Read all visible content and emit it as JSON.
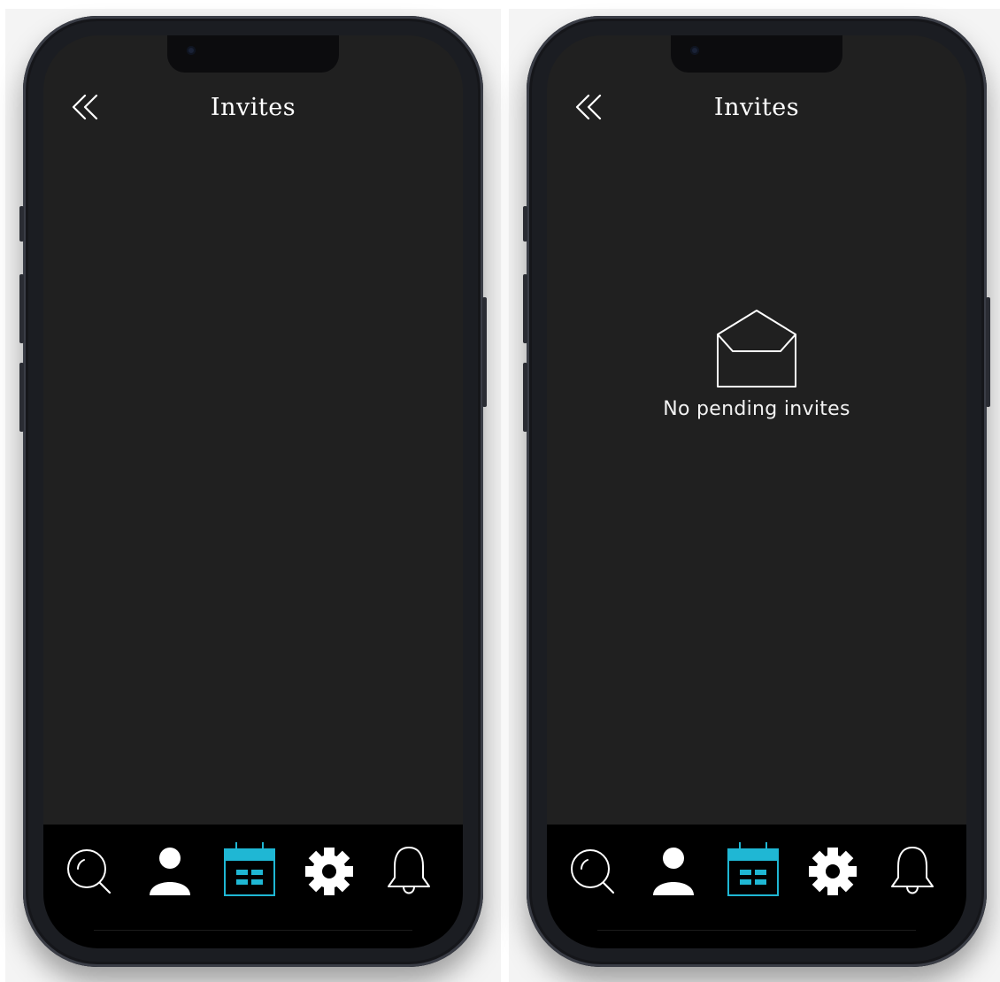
{
  "theme": {
    "accent": "#1fb7d4",
    "screen_bg": "#202020",
    "tabbar_bg": "#000000",
    "text": "#ffffff"
  },
  "screens": [
    {
      "header": {
        "title": "Invites",
        "back_icon": "double-chevron-left-icon"
      },
      "empty_state": null,
      "tabs": [
        {
          "id": "search",
          "icon": "search-icon",
          "active": false
        },
        {
          "id": "profile",
          "icon": "person-icon",
          "active": false
        },
        {
          "id": "calendar",
          "icon": "calendar-icon",
          "active": true
        },
        {
          "id": "settings",
          "icon": "gear-icon",
          "active": false
        },
        {
          "id": "notifications",
          "icon": "bell-icon",
          "active": false
        }
      ]
    },
    {
      "header": {
        "title": "Invites",
        "back_icon": "double-chevron-left-icon"
      },
      "empty_state": {
        "icon": "open-envelope-icon",
        "text": "No pending invites"
      },
      "tabs": [
        {
          "id": "search",
          "icon": "search-icon",
          "active": false
        },
        {
          "id": "profile",
          "icon": "person-icon",
          "active": false
        },
        {
          "id": "calendar",
          "icon": "calendar-icon",
          "active": true
        },
        {
          "id": "settings",
          "icon": "gear-icon",
          "active": false
        },
        {
          "id": "notifications",
          "icon": "bell-icon",
          "active": false
        }
      ]
    }
  ]
}
